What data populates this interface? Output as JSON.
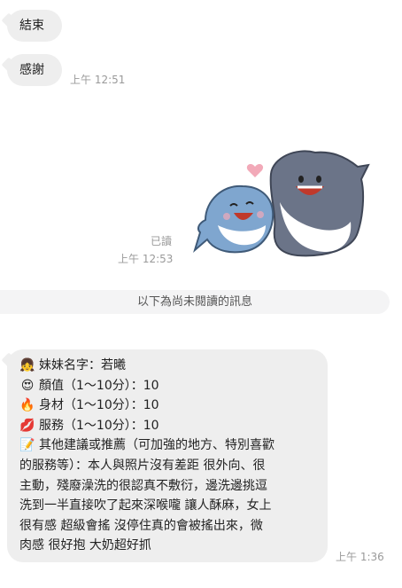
{
  "messages": {
    "m1": {
      "text": "結束"
    },
    "m2": {
      "text": "感謝",
      "time": "上午 12:51"
    },
    "sticker": {
      "read": "已讀",
      "time": "上午 12:53"
    },
    "unread_divider": "以下為尚未閱讀的訊息",
    "m3": {
      "time": "上午 1:36",
      "lines": [
        {
          "icon": "girl-face-icon",
          "glyph": "👧",
          "text": "妹妹名字：若曦"
        },
        {
          "icon": "heart-eyes-icon",
          "glyph": "😍",
          "text": "顏值（1～10分）：10"
        },
        {
          "icon": "fire-icon",
          "glyph": "🔥",
          "text": "身材（1～10分）：10"
        },
        {
          "icon": "lips-icon",
          "glyph": "💋",
          "text": "服務（1～10分）：10"
        }
      ],
      "para": {
        "icon": "memo-icon",
        "glyph": "📝",
        "rows": [
          "其他建議或推薦（可加強的地方、特別喜歡",
          "的服務等）：本人與照片沒有差距 很外向、很",
          "主動，殘廢澡洗的很認真不敷衍，邊洗邊挑逗",
          "洗到一半直接吹了起來深喉嚨 讓人酥麻，女上",
          "很有感 超級會搖 沒停住真的會被搖出來，微",
          "肉感 很好抱 大奶超好抓"
        ]
      }
    }
  },
  "colors": {
    "bubble_bg": "#eeeeee",
    "time": "#9a9a9a",
    "shark_big": "#6b7488",
    "shark_small": "#7fa6cf"
  }
}
